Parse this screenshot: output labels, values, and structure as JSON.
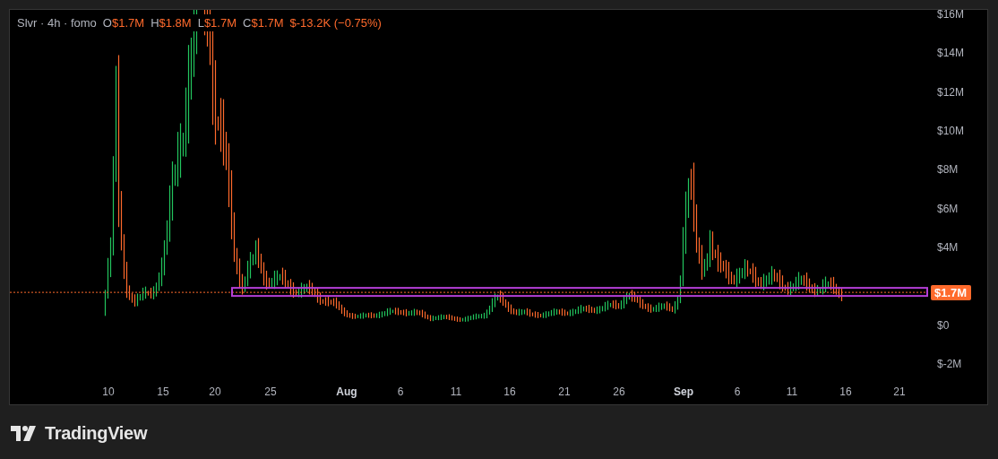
{
  "legend": {
    "symbol": "Slvr · 4h · fomo",
    "values": [
      {
        "key": "O",
        "value": "$1.7M"
      },
      {
        "key": "H",
        "value": "$1.8M"
      },
      {
        "key": "L",
        "value": "$1.7M"
      },
      {
        "key": "C",
        "value": "$1.7M"
      }
    ],
    "change": "$-13.2K (−0.75%)"
  },
  "price_axis": [
    "$16M",
    "$14M",
    "$12M",
    "$10M",
    "$8M",
    "$6M",
    "$4M",
    "$0",
    "$-2M"
  ],
  "last_price": "$1.7M",
  "time_axis": [
    {
      "label": "10",
      "kind": "day"
    },
    {
      "label": "15",
      "kind": "day"
    },
    {
      "label": "20",
      "kind": "day"
    },
    {
      "label": "25",
      "kind": "day"
    },
    {
      "label": "Aug",
      "kind": "month"
    },
    {
      "label": "6",
      "kind": "day"
    },
    {
      "label": "11",
      "kind": "day"
    },
    {
      "label": "16",
      "kind": "day"
    },
    {
      "label": "21",
      "kind": "day"
    },
    {
      "label": "26",
      "kind": "day"
    },
    {
      "label": "Sep",
      "kind": "month"
    },
    {
      "label": "6",
      "kind": "day"
    },
    {
      "label": "11",
      "kind": "day"
    },
    {
      "label": "16",
      "kind": "day"
    },
    {
      "label": "21",
      "kind": "day"
    }
  ],
  "brand": "TradingView"
}
